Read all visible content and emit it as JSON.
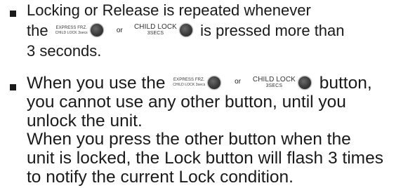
{
  "doc": {
    "bullet1": {
      "line1": "Locking or Release is repeated whenever",
      "line2_before": "the",
      "or": "or",
      "line2_after": "is pressed more than",
      "line3": "3 seconds."
    },
    "bullet2": {
      "line1_before": "When you use the",
      "or": "or",
      "line1_after": "button,",
      "line2": "you cannot use any other button, until you",
      "line3": "unlock the unit.",
      "line4": "When you press the other button when the",
      "line5": "unit is locked, the Lock button will flash 3 times",
      "line6": "to notify the current Lock condition."
    },
    "buttons": {
      "express_main": "EXPRESS FRZ.",
      "express_sub": "CHILD LOCK 3secs",
      "child_main": "CHILD LOCK",
      "child_sub": "3SECS"
    }
  },
  "colors": {
    "text": "#1a1a1a",
    "button_fill": "#3a3a3a"
  },
  "icons": [
    "bullet-square",
    "round-button-icon"
  ]
}
